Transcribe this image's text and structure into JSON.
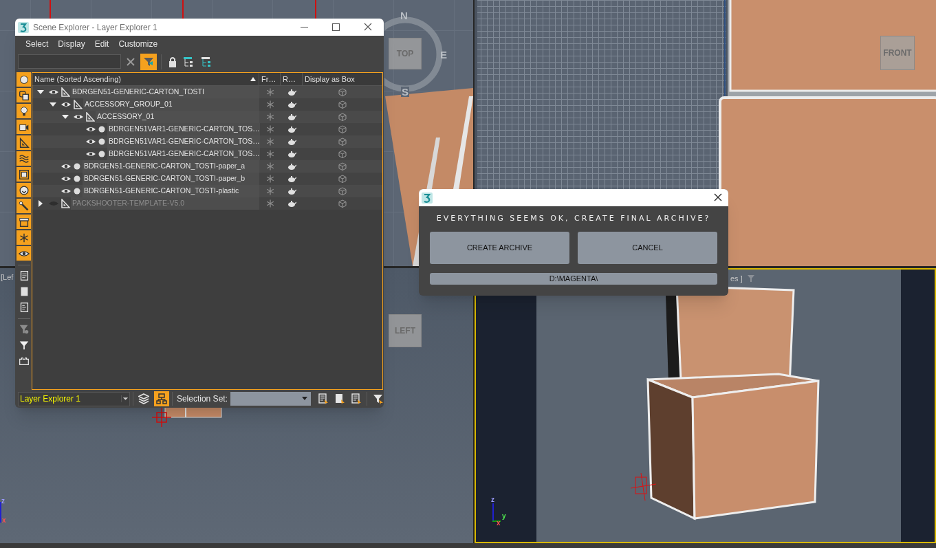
{
  "viewports": [
    {
      "kind": "top",
      "active": false,
      "viewcube": "TOP",
      "compass": {
        "north": "N",
        "east": "E",
        "south": "S"
      }
    },
    {
      "kind": "front",
      "active": false,
      "viewcube": "FRONT"
    },
    {
      "kind": "left",
      "active": false,
      "label": "[Lef",
      "viewcube": "LEFT",
      "axes": [
        "z",
        "x"
      ]
    },
    {
      "kind": "perspective",
      "active": true,
      "label": "es ]",
      "axes": [
        "z",
        "y",
        "x"
      ]
    }
  ],
  "scene_explorer": {
    "title": "Scene Explorer - Layer Explorer 1",
    "menu": [
      "Select",
      "Display",
      "Edit",
      "Customize"
    ],
    "toolbar": {
      "filter_selected": true
    },
    "side_tools": [
      {
        "kind": "geometry",
        "on": true
      },
      {
        "kind": "shapes",
        "on": true
      },
      {
        "kind": "lights",
        "on": true
      },
      {
        "kind": "cameras",
        "on": true
      },
      {
        "kind": "helpers",
        "on": true
      },
      {
        "kind": "spacewarps",
        "on": true
      },
      {
        "kind": "groups",
        "on": true
      },
      {
        "kind": "xrefs",
        "on": true
      },
      {
        "kind": "bones",
        "on": true
      },
      {
        "kind": "containers",
        "on": true
      },
      {
        "kind": "frozen",
        "on": true
      },
      {
        "kind": "hidden",
        "on": true
      },
      {
        "kind": "select_all",
        "on": false
      },
      {
        "kind": "select_none",
        "on": false
      },
      {
        "kind": "select_invert",
        "on": false
      },
      {
        "kind": "filter_settings",
        "on": false
      },
      {
        "kind": "filter",
        "on": false
      },
      {
        "kind": "bracket",
        "on": false
      }
    ],
    "columns": [
      "Name (Sorted Ascending)",
      "Fr…",
      "R…",
      "Display as Box"
    ],
    "sort_ascending": true,
    "tree": [
      {
        "kind": "layer",
        "name": "BDRGEN51-GENERIC-CARTON_TOSTI",
        "visible": true,
        "expanded": true,
        "children": [
          {
            "kind": "layer",
            "name": "ACCESSORY_GROUP_01",
            "visible": true,
            "expanded": true,
            "children": [
              {
                "kind": "layer",
                "name": "ACCESSORY_01",
                "visible": true,
                "expanded": true,
                "children": [
                  {
                    "kind": "object",
                    "name": "BDRGEN51VAR1-GENERIC-CARTON_TOS…",
                    "visible": true
                  },
                  {
                    "kind": "object",
                    "name": "BDRGEN51VAR1-GENERIC-CARTON_TOS…",
                    "visible": true
                  },
                  {
                    "kind": "object",
                    "name": "BDRGEN51VAR1-GENERIC-CARTON_TOS…",
                    "visible": true
                  }
                ]
              }
            ]
          },
          {
            "kind": "object",
            "name": "BDRGEN51-GENERIC-CARTON_TOSTI-paper_a",
            "visible": true
          },
          {
            "kind": "object",
            "name": "BDRGEN51-GENERIC-CARTON_TOSTI-paper_b",
            "visible": true
          },
          {
            "kind": "object",
            "name": "BDRGEN51-GENERIC-CARTON_TOSTI-plastic",
            "visible": true
          }
        ]
      },
      {
        "kind": "layer",
        "name": "PACKSHOOTER-TEMPLATE-V5.0",
        "visible": false,
        "expanded": false
      }
    ],
    "footer": {
      "explorer": "Layer Explorer 1",
      "layers_mode_selected": false,
      "hierarchy_mode_selected": true,
      "selection_set_label": "Selection Set:"
    }
  },
  "dialog": {
    "message": "EVERYTHING SEEMS OK, CREATE FINAL ARCHIVE?",
    "buttons": [
      "CREATE ARCHIVE",
      "CANCEL"
    ],
    "path": "D:\\MAGENTA\\"
  }
}
